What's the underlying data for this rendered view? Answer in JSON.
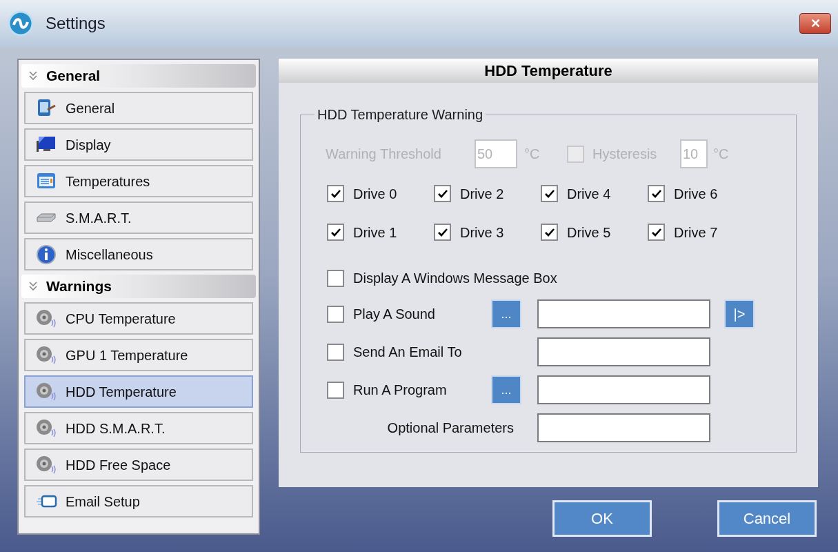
{
  "window": {
    "title": "Settings",
    "close": "✕"
  },
  "sidebar": {
    "sections": [
      {
        "title": "General",
        "items": [
          {
            "label": "General",
            "selected": false
          },
          {
            "label": "Display",
            "selected": false
          },
          {
            "label": "Temperatures",
            "selected": false
          },
          {
            "label": "S.M.A.R.T.",
            "selected": false
          },
          {
            "label": "Miscellaneous",
            "selected": false
          }
        ]
      },
      {
        "title": "Warnings",
        "items": [
          {
            "label": "CPU Temperature",
            "selected": false
          },
          {
            "label": "GPU 1 Temperature",
            "selected": false
          },
          {
            "label": "HDD Temperature",
            "selected": true
          },
          {
            "label": "HDD S.M.A.R.T.",
            "selected": false
          },
          {
            "label": "HDD Free Space",
            "selected": false
          },
          {
            "label": "Email Setup",
            "selected": false
          }
        ]
      }
    ]
  },
  "panel": {
    "title": "HDD Temperature",
    "group": "HDD Temperature Warning",
    "threshold": {
      "label": "Warning Threshold",
      "value": "50",
      "unit": "°C",
      "disabled": true
    },
    "hysteresis": {
      "label": "Hysteresis",
      "checked": false,
      "value": "10",
      "unit": "°C",
      "disabled": true
    },
    "drives": [
      {
        "label": "Drive 0",
        "checked": true
      },
      {
        "label": "Drive 2",
        "checked": true
      },
      {
        "label": "Drive 4",
        "checked": true
      },
      {
        "label": "Drive 6",
        "checked": true
      },
      {
        "label": "Drive 1",
        "checked": true
      },
      {
        "label": "Drive 3",
        "checked": true
      },
      {
        "label": "Drive 5",
        "checked": true
      },
      {
        "label": "Drive 7",
        "checked": true
      }
    ],
    "actions": [
      {
        "kind": "check",
        "label": "Display A Windows Message Box",
        "checked": false
      },
      {
        "kind": "check",
        "label": "Play A Sound",
        "checked": false,
        "browse": "...",
        "field": true,
        "play": "|>"
      },
      {
        "kind": "check",
        "label": "Send An Email To",
        "checked": false,
        "field": true
      },
      {
        "kind": "check",
        "label": "Run A Program",
        "checked": false,
        "browse": "...",
        "field": true
      },
      {
        "kind": "text",
        "label": "Optional Parameters",
        "field": true
      }
    ]
  },
  "buttons": [
    "OK",
    "Cancel"
  ]
}
